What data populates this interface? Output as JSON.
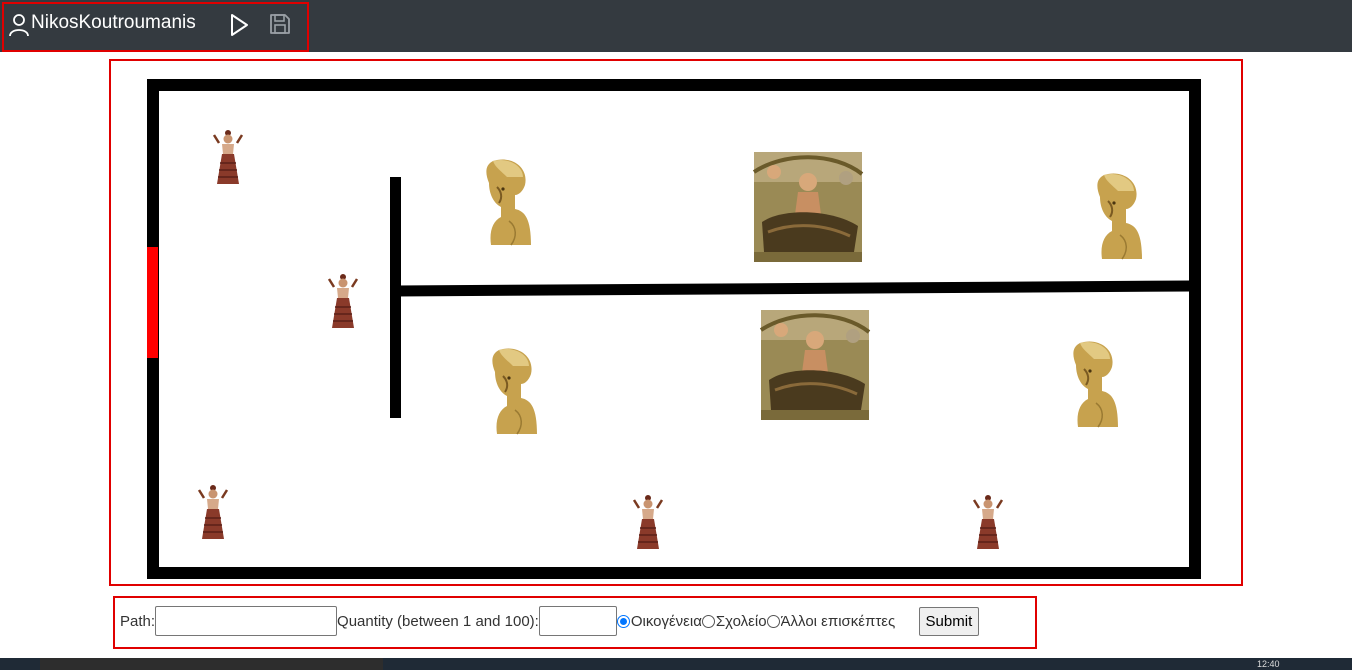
{
  "app": {
    "username": "NikosKoutroumanis",
    "accent_color": "#e00000",
    "topbar_color": "#343a40"
  },
  "toolbar": {
    "user_icon": "user-icon",
    "play_icon": "play-icon",
    "save_icon": "save-icon"
  },
  "map": {
    "exhibits": [
      {
        "kind": "snake-goddess-statue"
      },
      {
        "kind": "snake-goddess-statue"
      },
      {
        "kind": "snake-goddess-statue"
      },
      {
        "kind": "snake-goddess-statue"
      },
      {
        "kind": "snake-goddess-statue"
      },
      {
        "kind": "spartan-bust"
      },
      {
        "kind": "spartan-bust"
      },
      {
        "kind": "spartan-bust"
      },
      {
        "kind": "spartan-bust"
      },
      {
        "kind": "mosaic-painting"
      },
      {
        "kind": "mosaic-painting"
      }
    ],
    "entrance_color": "#ff0000",
    "wall_color": "#000000"
  },
  "form": {
    "path_label": "Path:",
    "path_value": "",
    "quantity_label": "Quantity (between 1 and 100):",
    "quantity_value": "",
    "visitor_types": [
      {
        "label": "Οικογένεια",
        "checked": true
      },
      {
        "label": "Σχολείο",
        "checked": false
      },
      {
        "label": "Άλλοι επισκέπτες",
        "checked": false
      }
    ],
    "submit_label": "Submit"
  },
  "taskbar": {
    "time": "12:40"
  }
}
